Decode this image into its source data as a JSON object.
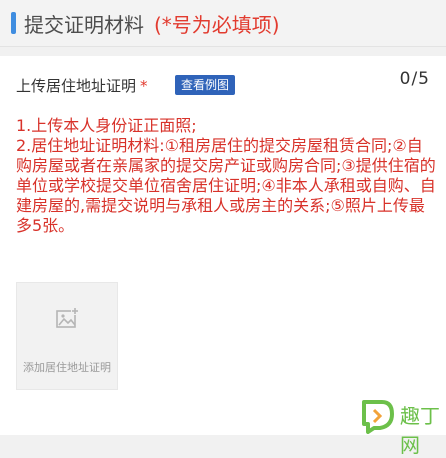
{
  "header": {
    "title": "提交证明材料",
    "hint": "(*号为必填项)",
    "accent_color": "#3f8de0"
  },
  "field": {
    "label": "上传居住地址证明",
    "required_mark": "*",
    "example_button_label": "查看例图",
    "counter": "0/5"
  },
  "instructions": [
    "1.上传本人身份证正面照;",
    "2.居住地址证明材料:①租房居住的提交房屋租赁合同;②自购房屋或者在亲属家的提交房产证或购房合同;③提供住宿的单位或学校提交单位宿舍居住证明;④非本人承租或自购、自建房屋的,需提交说明与承租人或房主的关系;⑤照片上传最多5张。"
  ],
  "upload": {
    "label": "添加居住地址证明",
    "icon": "add-image-icon"
  },
  "watermark": {
    "text": "趣丁网",
    "icon": "watermark-logo-icon"
  },
  "colors": {
    "warning": "#d8322a",
    "example_button": "#2f63b9"
  }
}
